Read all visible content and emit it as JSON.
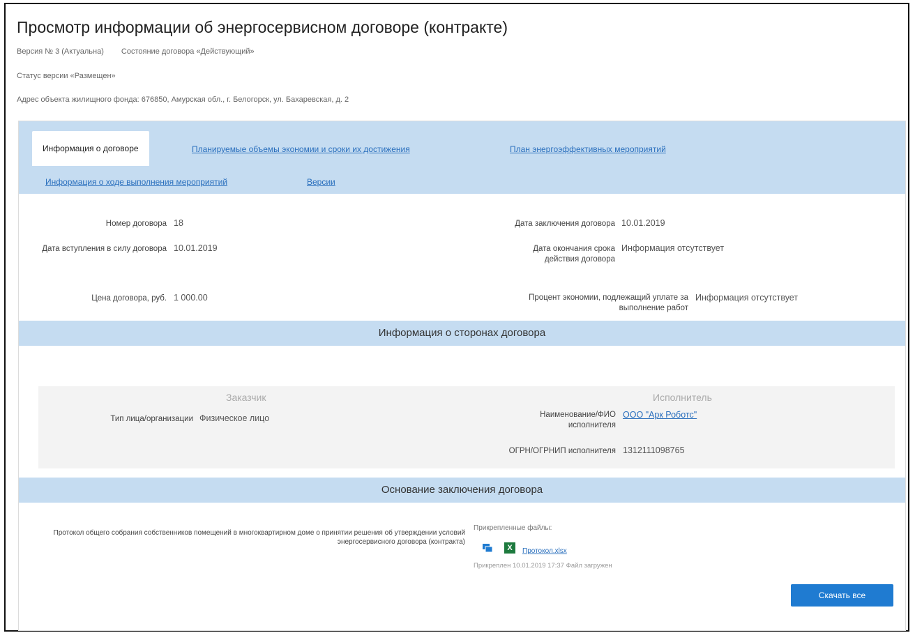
{
  "page": {
    "title": "Просмотр информации об энергосервисном договоре (контракте)",
    "version": "Версия № 3 (Актуальна)",
    "contract_state": "Состояние договора «Действующий»",
    "version_status": "Статус версии «Размещен»",
    "address": "Адрес объекта жилищного фонда: 676850, Амурская обл., г. Белогорск, ул. Бахаревская, д. 2"
  },
  "tabs": [
    {
      "label": "Информация о договоре",
      "active": true
    },
    {
      "label": "Планируемые объемы экономии и сроки их достижения",
      "active": false
    },
    {
      "label": "План энергоэффективных мероприятий",
      "active": false
    },
    {
      "label": "Информация о ходе выполнения мероприятий",
      "active": false
    },
    {
      "label": "Версии",
      "active": false
    }
  ],
  "info": {
    "contract_number_label": "Номер договора",
    "contract_number": "18",
    "effective_date_label": "Дата вступления в силу договора",
    "effective_date": "10.01.2019",
    "price_label": "Цена договора, руб.",
    "price": "1 000.00",
    "conclusion_date_label": "Дата заключения договора",
    "conclusion_date": "10.01.2019",
    "end_date_label": "Дата окончания срока действия договора",
    "end_date": "Информация отсутствует",
    "savings_percent_label": "Процент экономии, подлежащий уплате за выполнение работ",
    "savings_percent": "Информация отсутствует"
  },
  "parties_section": {
    "title": "Информация о сторонах договора",
    "customer_header": "Заказчик",
    "customer_type_label": "Тип лица/организации",
    "customer_type": "Физическое лицо",
    "executor_header": "Исполнитель",
    "executor_name_label": "Наименование/ФИО исполнителя",
    "executor_name": "ООО \"Арк Роботс\"",
    "executor_ogrn_label": "ОГРН/ОГРНИП исполнителя",
    "executor_ogrn": "1312111098765"
  },
  "basis_section": {
    "title": "Основание заключения договора",
    "protocol_label": "Протокол общего собрания собственников помещений в многоквартирном доме о принятии решения об утверждении условий энергосервисного договора (контракта)",
    "attached_files_label": "Прикрепленные файлы:",
    "file_name": "Протокол.xlsx",
    "file_info": "Прикреплен 10.01.2019 17:37   Файл загружен",
    "download_all": "Скачать все"
  },
  "colors": {
    "accent": "#1f7bd1",
    "band": "#c5dcf1",
    "link": "#2a6fbd",
    "excel": "#1d7a3e"
  },
  "icons": {
    "preview": "monitor-icon",
    "file": "excel-file-icon"
  }
}
